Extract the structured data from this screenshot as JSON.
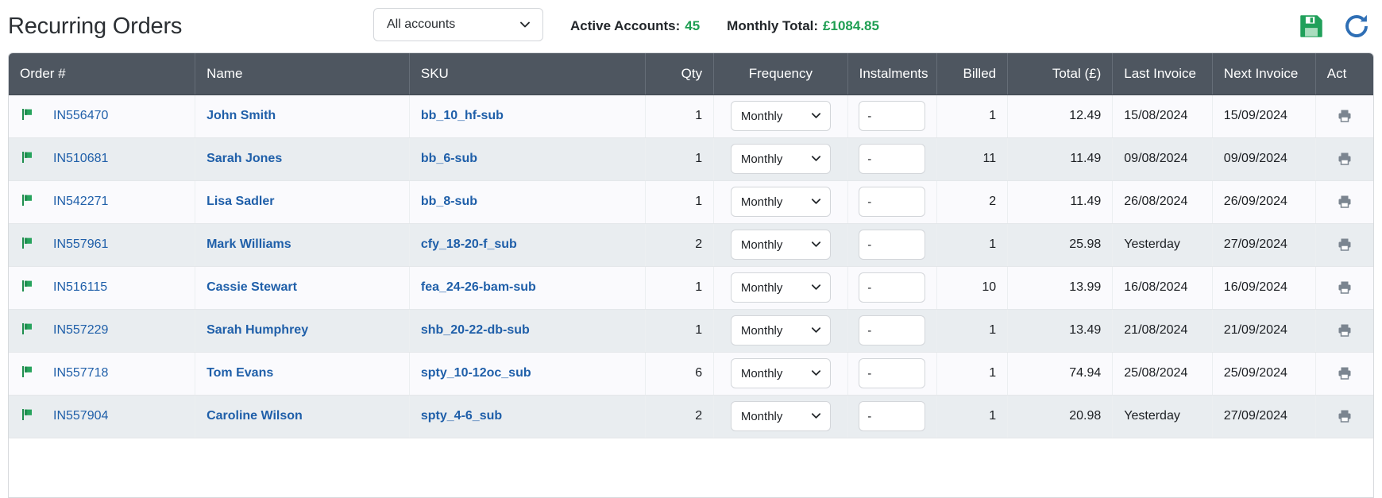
{
  "header": {
    "title": "Recurring Orders",
    "account_filter": {
      "value": "All accounts",
      "icon": "chevron-down-icon"
    },
    "active_accounts_label": "Active Accounts:",
    "active_accounts_value": "45",
    "monthly_total_label": "Monthly Total:",
    "monthly_total_value": "£1084.85",
    "save_icon": "save-floppy-icon",
    "refresh_icon": "refresh-icon",
    "accent_green": "#1e9e52",
    "accent_blue": "#2f6fb5"
  },
  "table": {
    "columns": [
      {
        "label": "Order #",
        "align": "left"
      },
      {
        "label": "Name",
        "align": "left"
      },
      {
        "label": "SKU",
        "align": "left"
      },
      {
        "label": "Qty",
        "align": "right"
      },
      {
        "label": "Frequency",
        "align": "center"
      },
      {
        "label": "Instalments",
        "align": "center"
      },
      {
        "label": "Billed",
        "align": "right"
      },
      {
        "label": "Total (£)",
        "align": "right"
      },
      {
        "label": "Last Invoice",
        "align": "left"
      },
      {
        "label": "Next Invoice",
        "align": "left"
      },
      {
        "label": "Act",
        "align": "left"
      }
    ],
    "header_bg": "#4e5660",
    "flag_icon": "flag-icon",
    "print_icon": "printer-icon",
    "rows": [
      {
        "flag": "flag-icon",
        "order": "IN556470",
        "name": "John Smith",
        "sku": "bb_10_hf-sub",
        "qty": "1",
        "frequency": "Monthly",
        "instalments": "-",
        "billed": "1",
        "total": "12.49",
        "last_invoice": "15/08/2024",
        "next_invoice": "15/09/2024",
        "action": "printer-icon"
      },
      {
        "flag": "flag-icon",
        "order": "IN510681",
        "name": "Sarah Jones",
        "sku": "bb_6-sub",
        "qty": "1",
        "frequency": "Monthly",
        "instalments": "-",
        "billed": "11",
        "total": "11.49",
        "last_invoice": "09/08/2024",
        "next_invoice": "09/09/2024",
        "action": "printer-icon"
      },
      {
        "flag": "flag-icon",
        "order": "IN542271",
        "name": "Lisa Sadler",
        "sku": "bb_8-sub",
        "qty": "1",
        "frequency": "Monthly",
        "instalments": "-",
        "billed": "2",
        "total": "11.49",
        "last_invoice": "26/08/2024",
        "next_invoice": "26/09/2024",
        "action": "printer-icon"
      },
      {
        "flag": "flag-icon",
        "order": "IN557961",
        "name": "Mark Williams",
        "sku": "cfy_18-20-f_sub",
        "qty": "2",
        "frequency": "Monthly",
        "instalments": "-",
        "billed": "1",
        "total": "25.98",
        "last_invoice": "Yesterday",
        "next_invoice": "27/09/2024",
        "action": "printer-icon"
      },
      {
        "flag": "flag-icon",
        "order": "IN516115",
        "name": "Cassie Stewart",
        "sku": "fea_24-26-bam-sub",
        "qty": "1",
        "frequency": "Monthly",
        "instalments": "-",
        "billed": "10",
        "total": "13.99",
        "last_invoice": "16/08/2024",
        "next_invoice": "16/09/2024",
        "action": "printer-icon"
      },
      {
        "flag": "flag-icon",
        "order": "IN557229",
        "name": "Sarah Humphrey",
        "sku": "shb_20-22-db-sub",
        "qty": "1",
        "frequency": "Monthly",
        "instalments": "-",
        "billed": "1",
        "total": "13.49",
        "last_invoice": "21/08/2024",
        "next_invoice": "21/09/2024",
        "action": "printer-icon"
      },
      {
        "flag": "flag-icon",
        "order": "IN557718",
        "name": "Tom Evans",
        "sku": "spty_10-12oc_sub",
        "qty": "6",
        "frequency": "Monthly",
        "instalments": "-",
        "billed": "1",
        "total": "74.94",
        "last_invoice": "25/08/2024",
        "next_invoice": "25/09/2024",
        "action": "printer-icon"
      },
      {
        "flag": "flag-icon",
        "order": "IN557904",
        "name": "Caroline Wilson",
        "sku": "spty_4-6_sub",
        "qty": "2",
        "frequency": "Monthly",
        "instalments": "-",
        "billed": "1",
        "total": "20.98",
        "last_invoice": "Yesterday",
        "next_invoice": "27/09/2024",
        "action": "printer-icon"
      }
    ]
  }
}
